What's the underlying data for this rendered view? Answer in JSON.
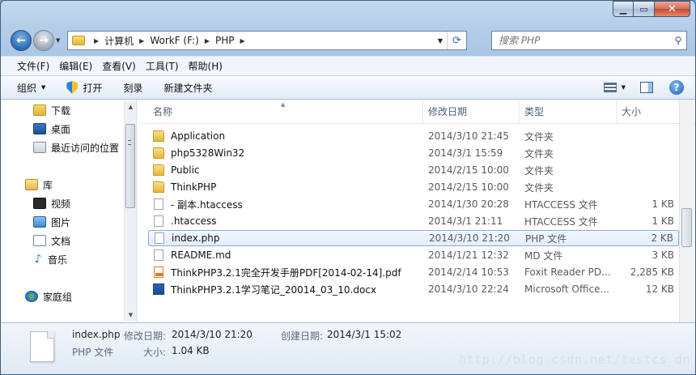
{
  "address": {
    "crumbs": [
      "计算机",
      "WorkF (F:)",
      "PHP"
    ]
  },
  "search": {
    "placeholder": "搜索 PHP"
  },
  "menubar": [
    "文件(F)",
    "编辑(E)",
    "查看(V)",
    "工具(T)",
    "帮助(H)"
  ],
  "toolbar": {
    "organize": "组织",
    "open": "打开",
    "burn": "刻录",
    "new_folder": "新建文件夹"
  },
  "sidebar": {
    "favorites": [
      "下载",
      "桌面",
      "最近访问的位置"
    ],
    "library": "库",
    "library_items": [
      "视频",
      "图片",
      "文档",
      "音乐"
    ],
    "homegroup": "家庭组"
  },
  "columns": {
    "name": "名称",
    "date": "修改日期",
    "type": "类型",
    "size": "大小"
  },
  "files": [
    {
      "icon": "folder-icon",
      "name": "Application",
      "date": "2014/3/10 21:45",
      "type": "文件夹",
      "size": ""
    },
    {
      "icon": "folder-icon",
      "name": "php5328Win32",
      "date": "2014/3/1 15:59",
      "type": "文件夹",
      "size": ""
    },
    {
      "icon": "folder-icon",
      "name": "Public",
      "date": "2014/2/15 10:00",
      "type": "文件夹",
      "size": ""
    },
    {
      "icon": "folder-icon",
      "name": "ThinkPHP",
      "date": "2014/2/15 10:00",
      "type": "文件夹",
      "size": ""
    },
    {
      "icon": "file-icon",
      "name": " - 副本.htaccess",
      "date": "2014/1/30 20:28",
      "type": "HTACCESS 文件",
      "size": "1 KB"
    },
    {
      "icon": "file-icon",
      "name": ".htaccess",
      "date": "2014/3/1 21:11",
      "type": "HTACCESS 文件",
      "size": "1 KB"
    },
    {
      "icon": "file-icon",
      "name": "index.php",
      "date": "2014/3/10 21:20",
      "type": "PHP 文件",
      "size": "2 KB"
    },
    {
      "icon": "file-icon",
      "name": "README.md",
      "date": "2014/1/21 12:32",
      "type": "MD 文件",
      "size": "3 KB"
    },
    {
      "icon": "pdf-icon",
      "name": "ThinkPHP3.2.1完全开发手册PDF[2014-02-14].pdf",
      "date": "2014/2/14 10:53",
      "type": "Foxit Reader PD...",
      "size": "2,285 KB"
    },
    {
      "icon": "word-doc-icon",
      "name": "ThinkPHP3.2.1学习笔记_20014_03_10.docx",
      "date": "2014/3/10 22:24",
      "type": "Microsoft Office...",
      "size": "12 KB"
    }
  ],
  "selected_index": 6,
  "details": {
    "filename": "index.php",
    "filetype": "PHP 文件",
    "modified_label": "修改日期:",
    "modified_value": "2014/3/10 21:20",
    "created_label": "创建日期:",
    "created_value": "2014/3/1 15:02",
    "size_label": "大小:",
    "size_value": "1.04 KB"
  },
  "watermark": "http://blog.csdn.net/testcs_dn"
}
